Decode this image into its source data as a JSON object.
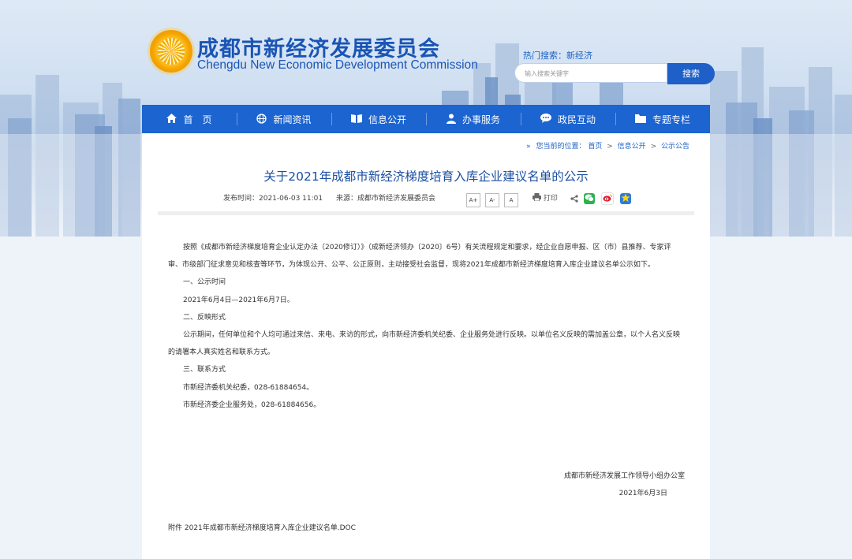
{
  "header": {
    "title_cn": "成都市新经济发展委员会",
    "title_en": "Chengdu New Economic Development Commission",
    "hot_search": "热门搜索：新经济",
    "search_placeholder": "输入搜索关键字",
    "search_button": "搜索"
  },
  "nav": {
    "items": [
      {
        "label": "首　页",
        "icon": "home-icon"
      },
      {
        "label": "新闻资讯",
        "icon": "globe-icon"
      },
      {
        "label": "信息公开",
        "icon": "book-icon"
      },
      {
        "label": "办事服务",
        "icon": "person-icon"
      },
      {
        "label": "政民互动",
        "icon": "chat-icon"
      },
      {
        "label": "专题专栏",
        "icon": "folder-icon"
      }
    ]
  },
  "breadcrumb": {
    "prefix": "您当前的位置：",
    "items": [
      "首页",
      "信息公开",
      "公示公告"
    ]
  },
  "article": {
    "title": "关于2021年成都市新经济梯度培育入库企业建议名单的公示",
    "publish_time": "发布时间：2021-06-03 11:01",
    "source": "来源：成都市新经济发展委员会",
    "font_buttons": [
      "A+",
      "A-",
      "A"
    ],
    "print_label": "打印",
    "paragraphs": [
      "按照《成都市新经济梯度培育企业认定办法（2020修订）》（成新经济领办〔2020〕6号）有关流程规定和要求，经企业自愿申报、区（市）县推荐、专家评审、市级部门征求意见和核查等环节，为体现公开、公平、公正原则，主动接受社会监督，现将2021年成都市新经济梯度培育入库企业建议名单公示如下。",
      "一、公示时间",
      "2021年6月4日—2021年6月7日。",
      "二、反映形式",
      "公示期间，任何单位和个人均可通过来信、来电、来访的形式，向市新经济委机关纪委、企业服务处进行反映。以单位名义反映的需加盖公章，以个人名义反映的请署本人真实姓名和联系方式。",
      "三、联系方式",
      "市新经济委机关纪委，028-61884654。",
      "市新经济委企业服务处，028-61884656。"
    ],
    "signature_org": "成都市新经济发展工作领导小组办公室",
    "signature_date": "2021年6月3日",
    "attachment": "附件 2021年成都市新经济梯度培育入库企业建议名单.DOC"
  },
  "colors": {
    "nav_bg": "#1c64d0",
    "title": "#1b4fa3",
    "link": "#1f62c3"
  }
}
